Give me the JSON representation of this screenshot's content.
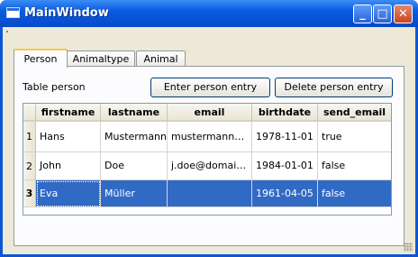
{
  "window": {
    "title": "MainWindow"
  },
  "title_buttons": {
    "minimize": "_",
    "maximize": "□",
    "close": "✕"
  },
  "tabs": [
    {
      "label": "Person",
      "active": true
    },
    {
      "label": "Animaltype",
      "active": false
    },
    {
      "label": "Animal",
      "active": false
    }
  ],
  "person_tab": {
    "table_label": "Table person",
    "enter_button": "Enter person entry",
    "delete_button": "Delete person entry"
  },
  "table": {
    "columns": [
      "firstname",
      "lastname",
      "email",
      "birthdate",
      "send_email"
    ],
    "rows": [
      {
        "num": "1",
        "cells": [
          "Hans",
          "Mustermann",
          "mustermann@d...",
          "1978-11-01",
          "true"
        ],
        "selected": false
      },
      {
        "num": "2",
        "cells": [
          "John",
          "Doe",
          "j.doe@domain....",
          "1984-01-01",
          "false"
        ],
        "selected": false
      },
      {
        "num": "3",
        "cells": [
          "Eva",
          "Müller",
          "",
          "1961-04-05",
          "false"
        ],
        "selected": true
      }
    ]
  },
  "colors": {
    "selection": "#316ac5",
    "titlebar": "#0a5ce0",
    "tab_highlight": "#ffc83c"
  }
}
